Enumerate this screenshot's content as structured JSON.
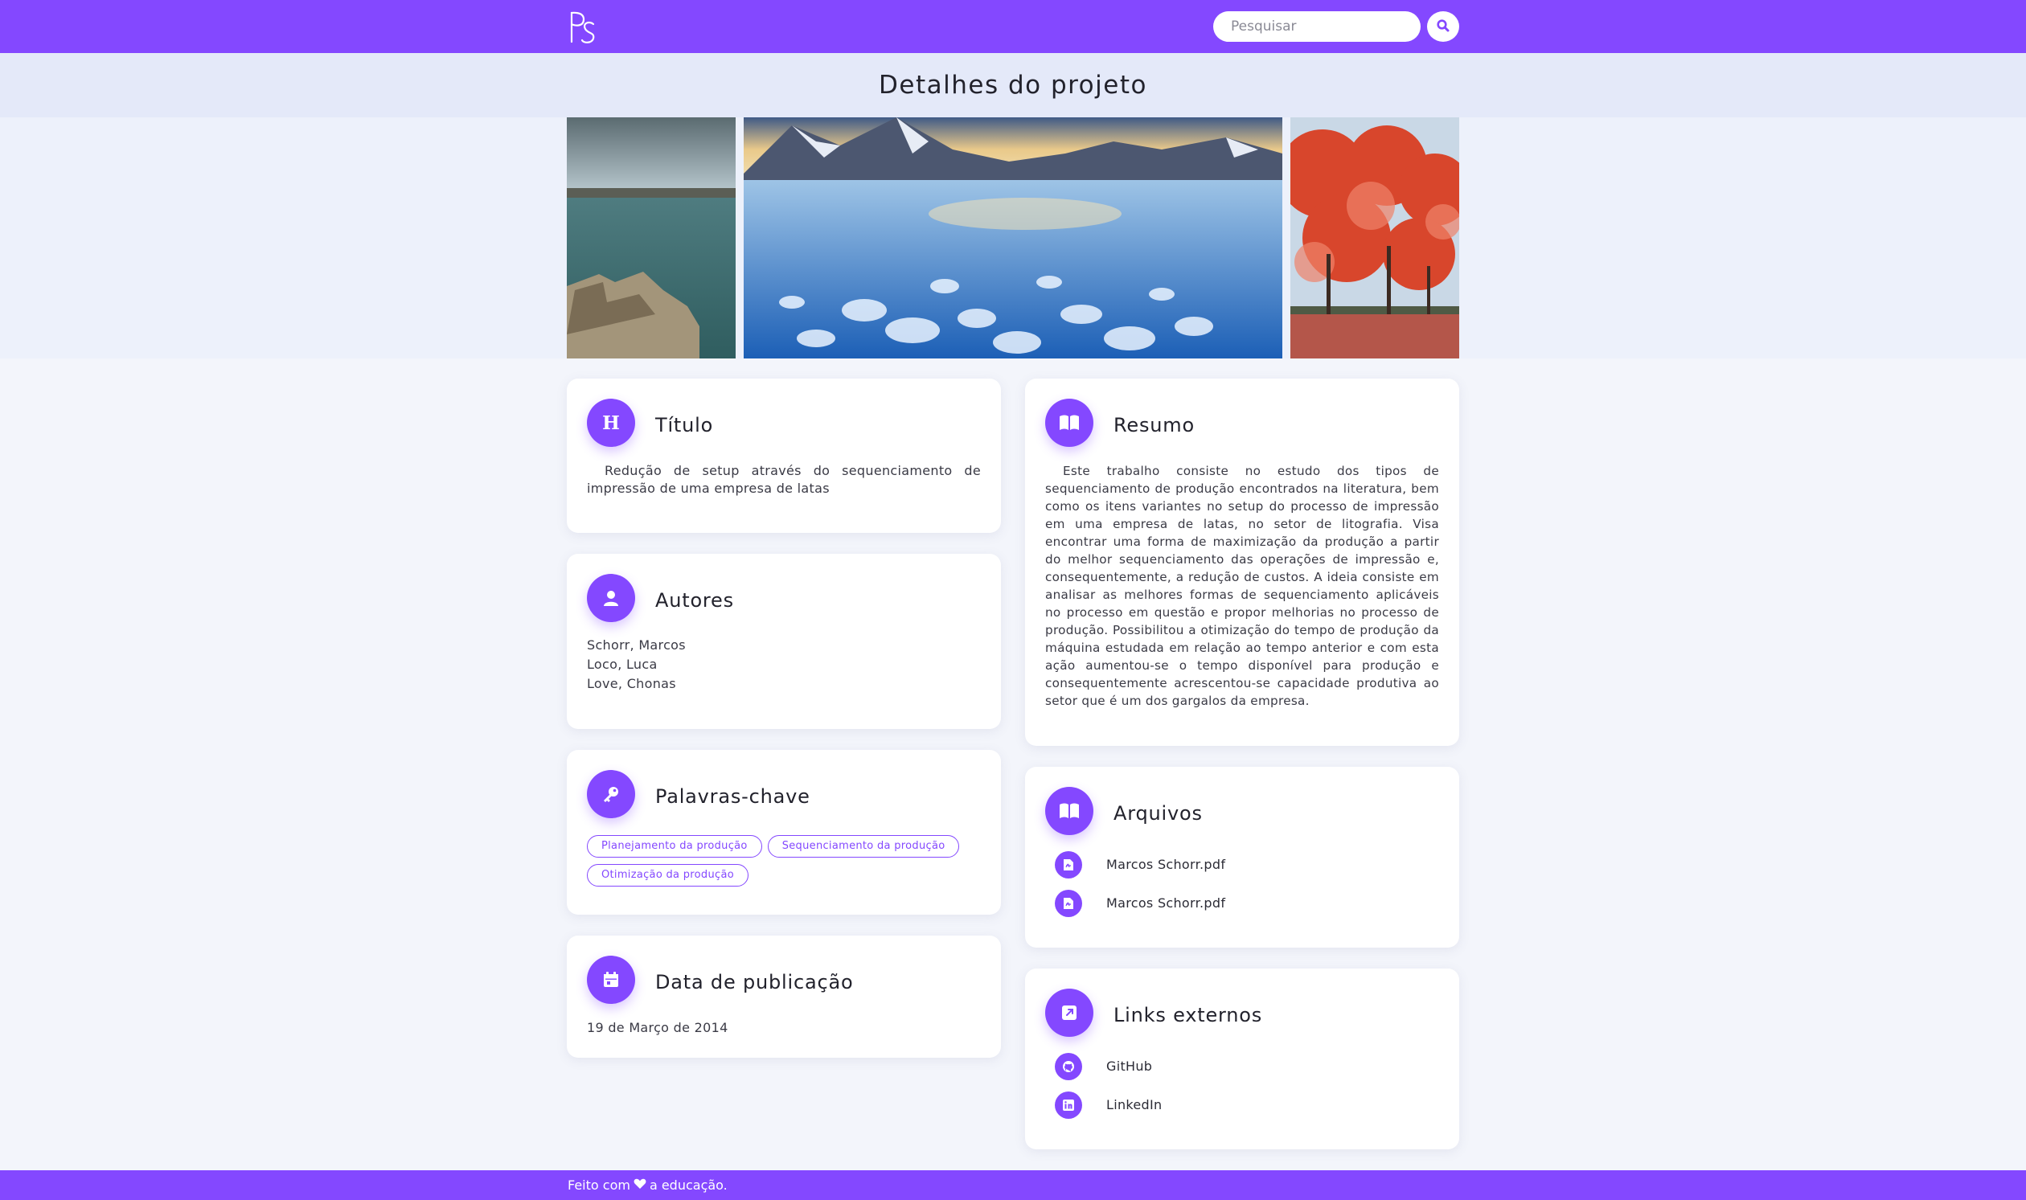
{
  "header": {
    "logo_text": "PS",
    "search_placeholder": "Pesquisar",
    "search_icon": "search-icon"
  },
  "page_title": "Detalhes do projeto",
  "gallery": [
    {
      "name": "photo-coastal-fortress",
      "description_icon": "image"
    },
    {
      "name": "photo-frozen-lake",
      "description_icon": "image"
    },
    {
      "name": "photo-autumn-trees",
      "description_icon": "image"
    }
  ],
  "cards": {
    "titulo": {
      "heading": "Título",
      "icon": "heading-icon",
      "text": "Redução de setup através do sequenciamento de impressão de uma empresa de latas"
    },
    "autores": {
      "heading": "Autores",
      "icon": "user-icon",
      "authors": [
        "Schorr, Marcos",
        "Loco, Luca",
        "Love, Chonas"
      ]
    },
    "palavras": {
      "heading": "Palavras-chave",
      "icon": "key-icon",
      "keywords": [
        "Planejamento da produção",
        "Sequenciamento da produção",
        "Otimização da produção"
      ]
    },
    "data": {
      "heading": "Data de publicação",
      "icon": "calendar-icon",
      "date": "19 de Março de 2014"
    },
    "resumo": {
      "heading": "Resumo",
      "icon": "book-icon",
      "text": "Este trabalho consiste no estudo dos tipos de sequenciamento de produção encontrados na literatura, bem como os itens variantes no setup do processo de impressão em uma empresa de latas, no setor de litografia. Visa encontrar uma forma de maximização da produção a partir do melhor sequenciamento das operações de impressão e, consequentemente, a redução de custos. A ideia consiste em analisar as melhores formas de sequenciamento aplicáveis no processo em questão e propor melhorias no processo de produção. Possibilitou a otimização do tempo de produção da máquina estudada em relação ao tempo anterior e com esta ação aumentou-se o tempo disponível para produção e consequentemente acrescentou-se capacidade produtiva ao setor que é um dos gargalos da empresa."
    },
    "arquivos": {
      "heading": "Arquivos",
      "icon": "book-icon",
      "files": [
        "Marcos Schorr.pdf",
        "Marcos Schorr.pdf"
      ]
    },
    "links": {
      "heading": "Links externos",
      "icon": "external-link-icon",
      "items": [
        {
          "label": "GitHub",
          "icon": "github-icon"
        },
        {
          "label": "LinkedIn",
          "icon": "linkedin-icon"
        }
      ]
    }
  },
  "footer": {
    "prefix": "Feito com",
    "suffix": "a educação."
  },
  "colors": {
    "accent": "#8448ff",
    "title_band": "#e4e9f9",
    "page_bg": "#f3f5fb"
  }
}
